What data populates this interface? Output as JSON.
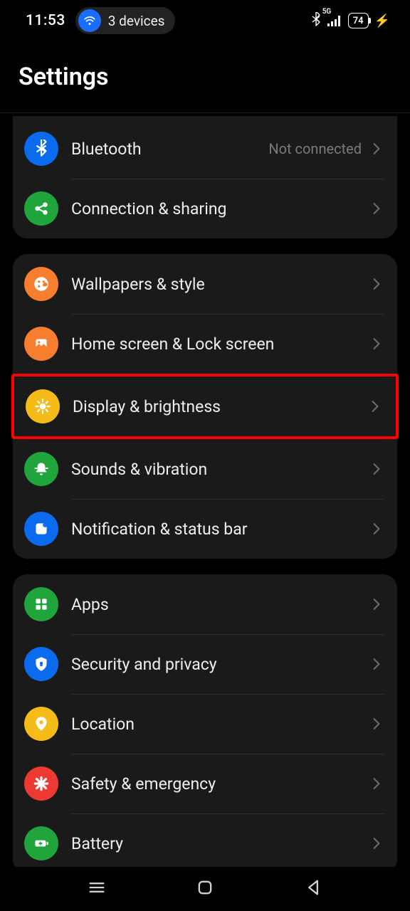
{
  "status": {
    "time": "11:53",
    "devices_label": "3 devices",
    "network": "5G",
    "battery": "74"
  },
  "header": {
    "title": "Settings"
  },
  "groups": [
    {
      "id": "connectivity",
      "items": [
        {
          "id": "bluetooth",
          "label": "Bluetooth",
          "status": "Not connected",
          "icon": "bluetooth-icon",
          "color": "bg-blue"
        },
        {
          "id": "connection-sharing",
          "label": "Connection & sharing",
          "status": "",
          "icon": "share-icon",
          "color": "bg-green"
        }
      ]
    },
    {
      "id": "personalization",
      "items": [
        {
          "id": "wallpapers",
          "label": "Wallpapers & style",
          "status": "",
          "icon": "palette-icon",
          "color": "bg-orange"
        },
        {
          "id": "home-lock",
          "label": "Home screen & Lock screen",
          "status": "",
          "icon": "picture-icon",
          "color": "bg-orange"
        },
        {
          "id": "display",
          "label": "Display & brightness",
          "status": "",
          "icon": "brightness-icon",
          "color": "bg-yellow",
          "highlighted": true
        },
        {
          "id": "sounds",
          "label": "Sounds & vibration",
          "status": "",
          "icon": "bell-icon",
          "color": "bg-green"
        },
        {
          "id": "notification",
          "label": "Notification & status bar",
          "status": "",
          "icon": "notification-icon",
          "color": "bg-blue"
        }
      ]
    },
    {
      "id": "system",
      "items": [
        {
          "id": "apps",
          "label": "Apps",
          "status": "",
          "icon": "apps-icon",
          "color": "bg-green"
        },
        {
          "id": "security",
          "label": "Security and privacy",
          "status": "",
          "icon": "shield-icon",
          "color": "bg-blue"
        },
        {
          "id": "location",
          "label": "Location",
          "status": "",
          "icon": "location-icon",
          "color": "bg-yellow"
        },
        {
          "id": "safety",
          "label": "Safety & emergency",
          "status": "",
          "icon": "emergency-icon",
          "color": "bg-red"
        },
        {
          "id": "battery",
          "label": "Battery",
          "status": "",
          "icon": "battery-icon",
          "color": "bg-green"
        }
      ]
    }
  ]
}
